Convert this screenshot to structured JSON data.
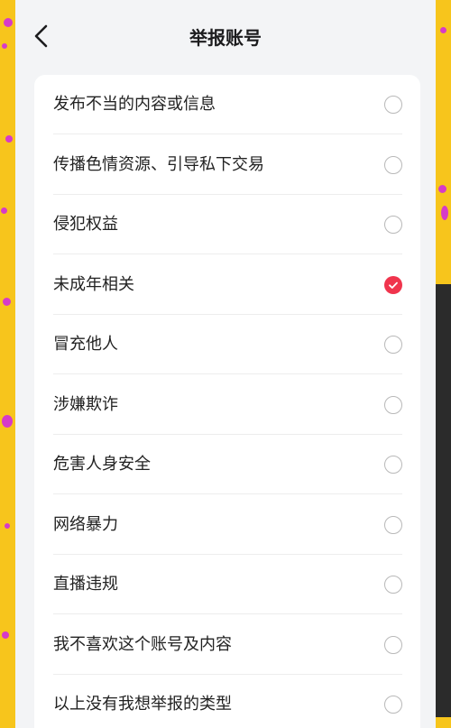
{
  "header": {
    "title": "举报账号",
    "back_icon": "chevron-left-icon"
  },
  "colors": {
    "accent": "#F0344D",
    "page_bg": "#F3F4F6",
    "outer_bg": "#F7C51C"
  },
  "options": [
    {
      "label": "发布不当的内容或信息",
      "selected": false
    },
    {
      "label": "传播色情资源、引导私下交易",
      "selected": false
    },
    {
      "label": "侵犯权益",
      "selected": false
    },
    {
      "label": "未成年相关",
      "selected": true
    },
    {
      "label": "冒充他人",
      "selected": false
    },
    {
      "label": "涉嫌欺诈",
      "selected": false
    },
    {
      "label": "危害人身安全",
      "selected": false
    },
    {
      "label": "网络暴力",
      "selected": false
    },
    {
      "label": "直播违规",
      "selected": false
    },
    {
      "label": "我不喜欢这个账号及内容",
      "selected": false
    },
    {
      "label": "以上没有我想举报的类型",
      "selected": false
    }
  ]
}
